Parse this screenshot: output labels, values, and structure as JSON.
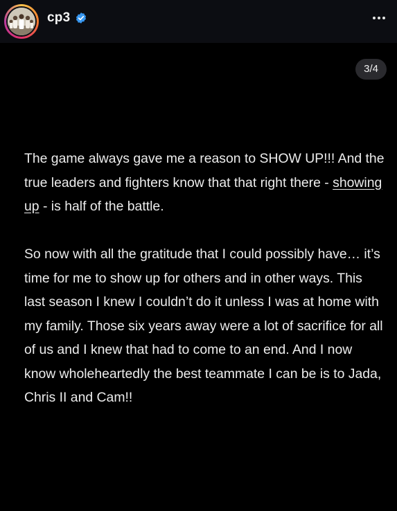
{
  "header": {
    "username": "cp3",
    "verified_icon": "verified-badge-icon",
    "more_icon": "more-options-icon"
  },
  "carousel": {
    "counter": "3/4"
  },
  "post": {
    "p1_a": "The game always gave me a reason to SHOW UP!!! And the true leaders and fighters know that that right there - ",
    "p1_link": "showing up",
    "p1_b": " - is half of the battle.",
    "p2": "So now with all the gratitude that I could possibly have… it’s time for me to show up for others and in other ways.  This last season I knew I couldn’t do it unless I was at home with my family. Those six years away were a lot of sacrifice for all of us and I knew that had to come to an end. And I now know wholeheartedly the best teammate I can be is to Jada, Chris II and Cam!!"
  },
  "colors": {
    "background": "#000000",
    "header_bg": "#0c0d12",
    "verified_blue": "#3897f0",
    "text": "#ececec"
  }
}
